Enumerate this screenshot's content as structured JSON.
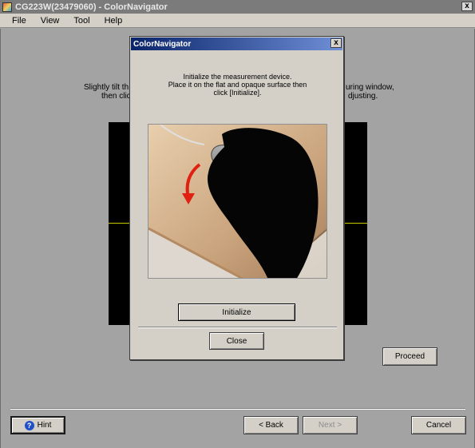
{
  "window": {
    "title": "CG223W(23479060) - ColorNavigator",
    "close_glyph": "x"
  },
  "menu": [
    {
      "label": "File"
    },
    {
      "label": "View"
    },
    {
      "label": "Tool"
    },
    {
      "label": "Help"
    }
  ],
  "background": {
    "instruction_left_1": "Slightly tilt th",
    "instruction_left_2": "then clic",
    "instruction_right_1": "uring window,",
    "instruction_right_2": "djusting."
  },
  "buttons": {
    "proceed": "Proceed",
    "hint": "Hint",
    "back": "< Back",
    "next": "Next >",
    "cancel": "Cancel"
  },
  "dialog": {
    "title": "ColorNavigator",
    "close_glyph": "x",
    "message_lines": [
      "Initialize the measurement device.",
      "Place it on the flat and opaque surface then",
      "click [Initialize]."
    ],
    "initialize_label": "Initialize",
    "close_label": "Close"
  },
  "colors": {
    "titlebar": "#7b7b7b",
    "dialog_title_start": "#0a246a",
    "dialog_title_end": "#6f8fd6",
    "background": "#a3a3a3",
    "panel": "#000000",
    "guide_line": "#c8c800",
    "arrow": "#e02010"
  },
  "icons": {
    "app": "colornavigator-app-icon",
    "hint": "question-icon"
  }
}
